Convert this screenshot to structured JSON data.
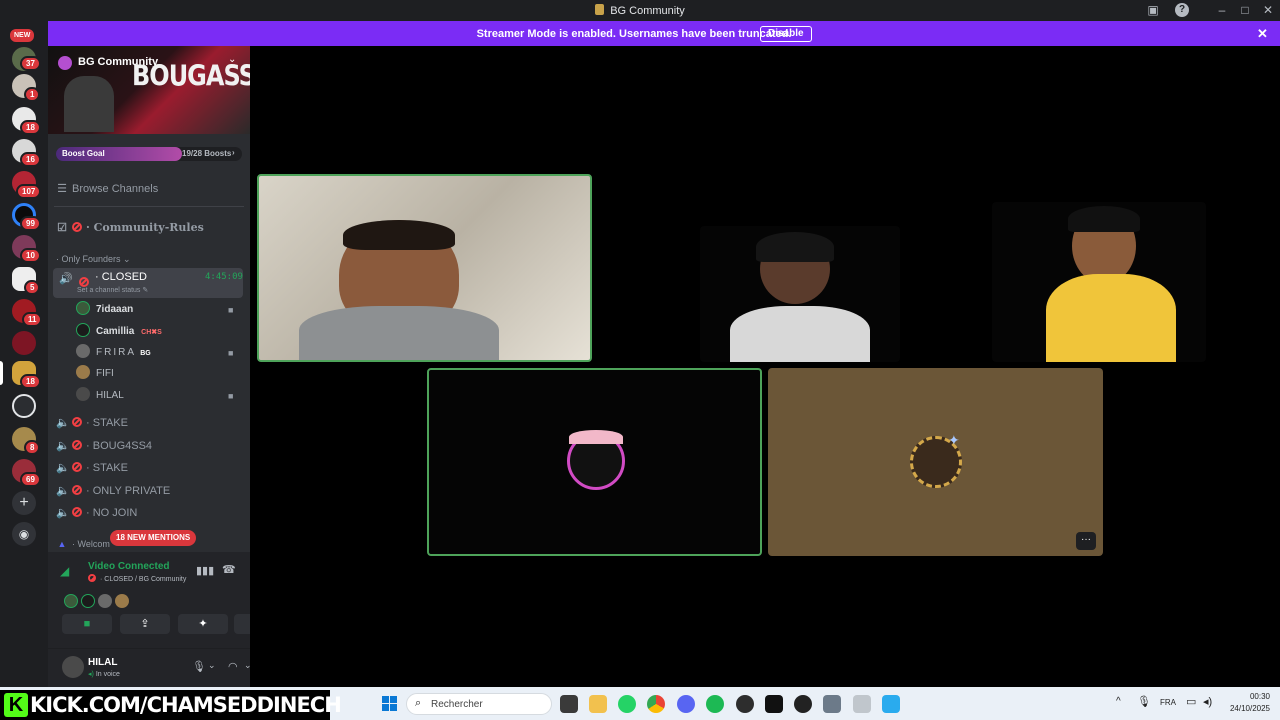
{
  "window": {
    "title": "BG Community"
  },
  "banner": {
    "message": "Streamer Mode is enabled. Usernames have been truncated.",
    "disable_label": "Disable"
  },
  "rail": {
    "new_label": "NEW",
    "badges": [
      "37",
      "1",
      "18",
      "16",
      "107",
      "99",
      "10",
      "5",
      "11",
      "18",
      "8",
      "69"
    ]
  },
  "server": {
    "name": "BG Community",
    "banner_art_text": "BOUGASSAA",
    "boost": {
      "label": "Boost Goal",
      "progress": "19/28 Boosts",
      "fraction": 0.68
    }
  },
  "channels": {
    "browse": "Browse Channels",
    "rules": "Community-Rules",
    "category": "Only Founders",
    "active": {
      "name": "CLOSED",
      "timer": "4:45:09",
      "status_hint": "Set a channel status"
    },
    "members": [
      {
        "name": "7idaaan",
        "tag": "",
        "camera": true
      },
      {
        "name": "Camillia",
        "tag": "CH✖S",
        "camera": false
      },
      {
        "name": "FRIRA",
        "tag": "BG",
        "camera": true
      },
      {
        "name": "FIFI",
        "tag": "",
        "camera": false
      },
      {
        "name": "HILAL",
        "tag": "",
        "camera": true
      }
    ],
    "voice": [
      "STAKE",
      "BOUG4SS4",
      "STAKE",
      "ONLY PRIVATE",
      "NO JOIN"
    ],
    "welcome": "Welcom",
    "mentions": "18 NEW MENTIONS"
  },
  "voice_panel": {
    "status": "Video Connected",
    "location": "CLOSED / BG Community"
  },
  "user": {
    "name": "HILAL",
    "status": "In voice"
  },
  "overlay": {
    "stream_url": "KICK.COM/CHAMSEDDINECH"
  },
  "taskbar": {
    "search_placeholder": "Rechercher",
    "lang": "FRA",
    "time": "00:30",
    "date": "24/10/2025"
  },
  "colors": {
    "accent": "#7b2cf5",
    "online": "#23a55a",
    "danger": "#f23f43",
    "tile_brown": "#6b5637",
    "kick_green": "#53fc18"
  }
}
